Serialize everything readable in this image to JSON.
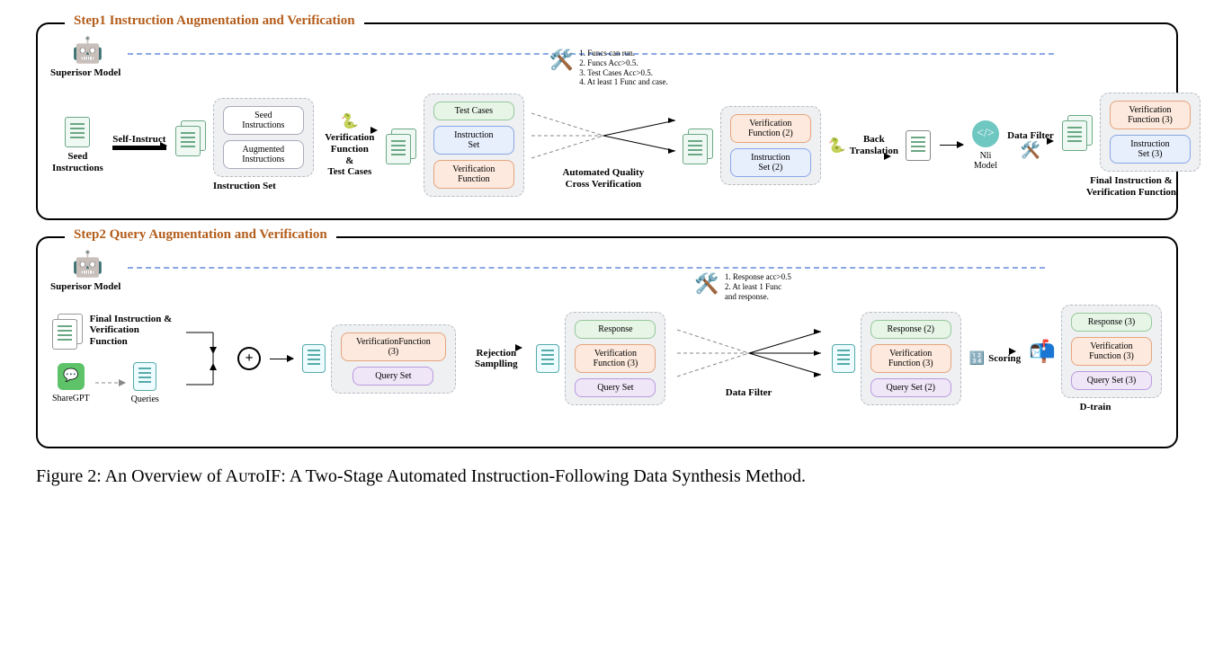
{
  "step1": {
    "title": "Step1 Instruction Augmentation and Verification",
    "superior_model": "Superisor Model",
    "seed_instructions": "Seed\nInstructions",
    "self_instruct": "Self-Instruct",
    "instruction_set_label": "Instruction Set",
    "pill_seed": "Seed\nInstructions",
    "pill_augmented": "Augmented\nInstructions",
    "vf_and_tc": "Verification\nFunction\n&\nTest Cases",
    "test_cases": "Test Cases",
    "instruction_set": "Instruction\nSet",
    "verification_function": "Verification\nFunction",
    "rules": {
      "r1": "1. Funcs can run.",
      "r2": "2. Funcs Acc>0.5.",
      "r3": "3. Test Cases Acc>0.5.",
      "r4": "4. At least 1 Func and case."
    },
    "automated_quality": "Automated Quality\nCross Verification",
    "vf2": "Verification\nFunction (2)",
    "is2": "Instruction\nSet (2)",
    "back_translation": "Back Translation",
    "nli_model": "Nli Model",
    "data_filter": "Data Filter",
    "vf3": "Verification\nFunction (3)",
    "is3": "Instruction\nSet (3)",
    "final_label": "Final Instruction &\nVerification Function"
  },
  "step2": {
    "title": "Step2  Query Augmentation and Verification",
    "superior_model": "Superisor Model",
    "final_ivf": "Final Instruction &\nVerification Function",
    "sharegpt": "ShareGPT",
    "queries": "Queries",
    "vf3": "VerificationFunction (3)",
    "query_set": "Query Set",
    "rejection_sampling": "Rejection\nSamplling",
    "response": "Response",
    "vf3b": "Verification\nFunction (3)",
    "query_set_b": "Query Set",
    "rules": {
      "r1": "1. Response acc>0.5",
      "r2": "2. At least 1 Func\nand response."
    },
    "data_filter": "Data Filter",
    "response2": "Response (2)",
    "vf3c": "Verification\nFunction (3)",
    "query_set2": "Query Set (2)",
    "scoring": "Scoring",
    "response3": "Response (3)",
    "vf3d": "Verification\nFunction (3)",
    "query_set3": "Query Set (3)",
    "dtrain": "D-train"
  },
  "caption": "Figure 2: An Overview of AᴜᴛᴏIF: A Two-Stage Automated Instruction-Following Data Synthesis Method."
}
